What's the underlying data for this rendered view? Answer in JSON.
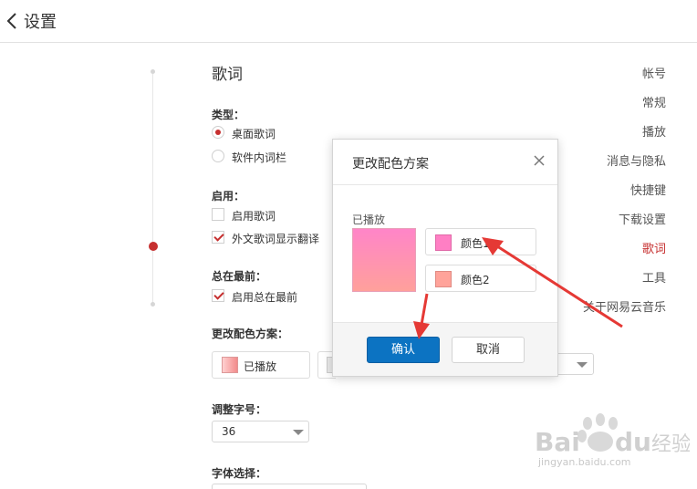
{
  "header": {
    "title": "设置"
  },
  "sidebar": {
    "items": [
      {
        "label": "帐号",
        "active": false
      },
      {
        "label": "常规",
        "active": false
      },
      {
        "label": "播放",
        "active": false
      },
      {
        "label": "消息与隐私",
        "active": false
      },
      {
        "label": "快捷键",
        "active": false
      },
      {
        "label": "下载设置",
        "active": false
      },
      {
        "label": "歌词",
        "active": true
      },
      {
        "label": "工具",
        "active": false
      },
      {
        "label": "关于网易云音乐",
        "active": false
      }
    ]
  },
  "main": {
    "section_title": "歌词",
    "type": {
      "label": "类型：",
      "options": [
        {
          "label": "桌面歌词",
          "selected": true
        },
        {
          "label": "软件内词栏",
          "selected": false
        }
      ]
    },
    "enable": {
      "label": "启用：",
      "options": [
        {
          "label": "启用歌词",
          "checked": false
        },
        {
          "label": "外文歌词显示翻译",
          "checked": true
        }
      ]
    },
    "on_top": {
      "label": "总在最前：",
      "options": [
        {
          "label": "启用总在最前",
          "checked": true
        }
      ]
    },
    "color_scheme": {
      "label": "更改配色方案：",
      "played_label": "已播放"
    },
    "font_size": {
      "label": "调整字号：",
      "value": "36"
    },
    "font_select": {
      "label": "字体选择："
    }
  },
  "dialog": {
    "title": "更改配色方案",
    "preview_label": "已播放",
    "color1_label": "颜色1",
    "color2_label": "颜色2",
    "confirm_label": "确认",
    "cancel_label": "取消"
  },
  "colors": {
    "accent": "#c62f2f",
    "primary_button": "#0c73c2",
    "color1": "#ff7fc4",
    "color2": "#ffa39a",
    "annotation_arrow": "#e53935"
  },
  "watermark": {
    "brand": "Baidu经验",
    "url": "jingyan.baidu.com"
  }
}
